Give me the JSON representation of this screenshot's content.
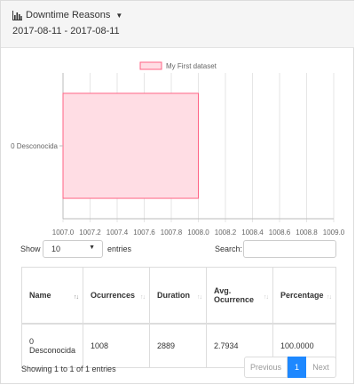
{
  "header": {
    "title": "Downtime Reasons",
    "date_range": "2017-08-11 - 2017-08-11",
    "icon": "bar-chart-icon"
  },
  "chart_data": {
    "type": "bar",
    "orientation": "horizontal",
    "categories": [
      "0 Desconocida"
    ],
    "series": [
      {
        "name": "My First dataset",
        "values": [
          1008
        ],
        "fill": "#ffdde4",
        "stroke": "#ff6384"
      }
    ],
    "xlim": [
      1007.0,
      1009.0
    ],
    "x_ticks": [
      "1007.0",
      "1007.2",
      "1007.4",
      "1007.6",
      "1007.8",
      "1008.0",
      "1008.2",
      "1008.4",
      "1008.6",
      "1008.8",
      "1009.0"
    ],
    "grid": true,
    "legend": "top"
  },
  "table": {
    "show_label": "Show",
    "length_value": "10",
    "entries_label": "entries",
    "search_label": "Search:",
    "columns": [
      "Name",
      "Ocurrences",
      "Duration",
      "Avg. Ocurrence",
      "Percentage"
    ],
    "rows": [
      [
        "0 Desconocida",
        "1008",
        "2889",
        "2.7934",
        "100.0000"
      ]
    ],
    "info": "Showing 1 to 1 of 1 entries",
    "pagination": {
      "previous": "Previous",
      "current": "1",
      "next": "Next"
    }
  }
}
